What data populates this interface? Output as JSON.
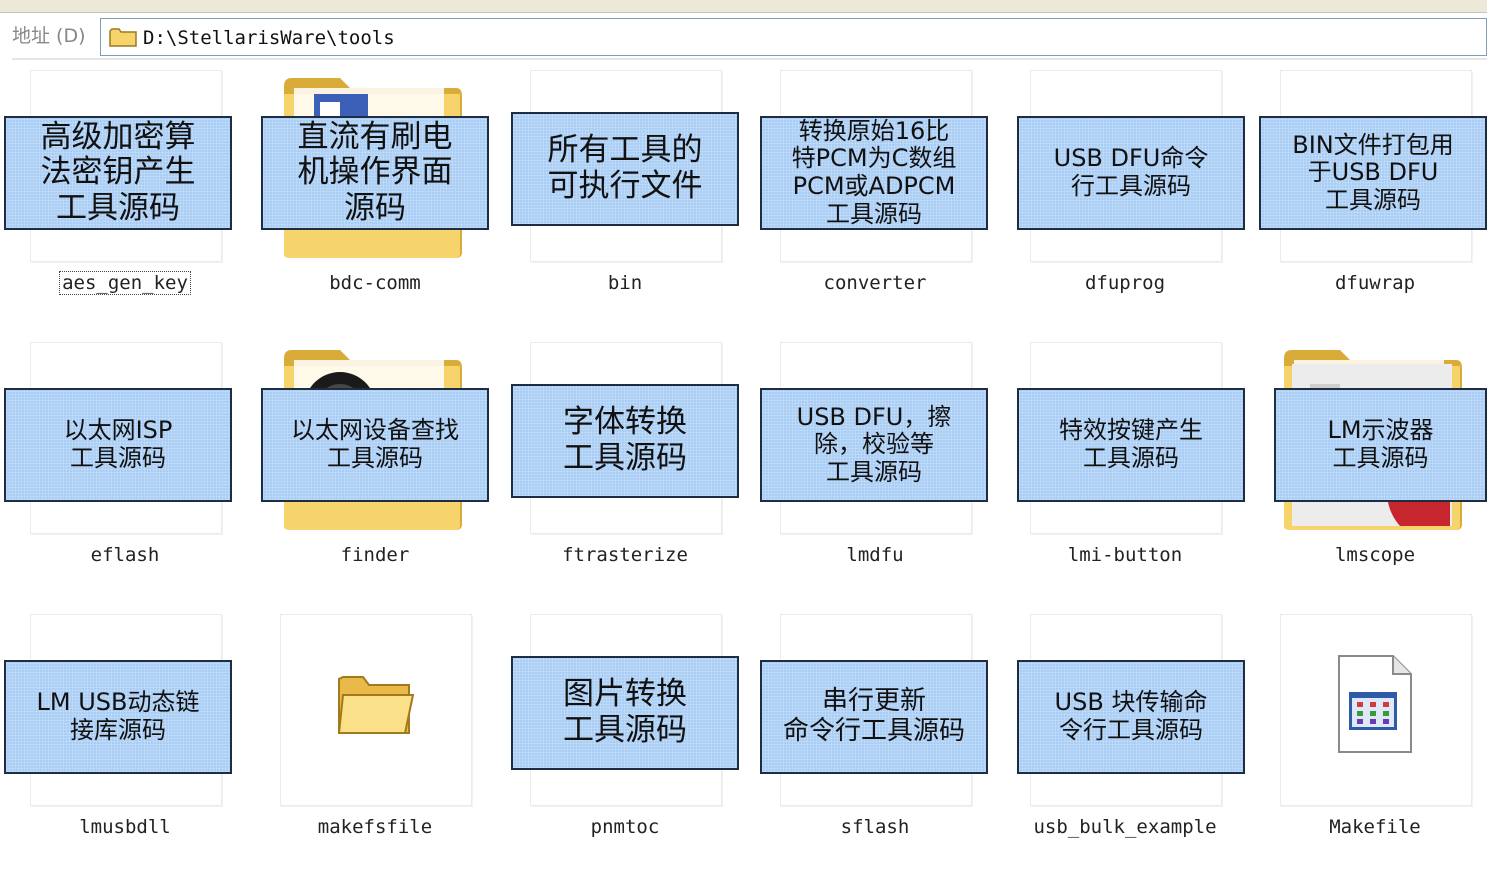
{
  "address_bar": {
    "label": "地址 (D)",
    "path": "D:\\StellarisWare\\tools"
  },
  "items": [
    {
      "name": "aes_gen_key",
      "note": "高级加密算\n法密钥产生\n工具源码",
      "icon": "blank-thumbnail"
    },
    {
      "name": "bdc-comm",
      "note": "直流有刷电\n机操作界面\n源码",
      "icon": "folder-icon"
    },
    {
      "name": "bin",
      "note": "所有工具的\n可执行文件",
      "icon": "blank-thumbnail"
    },
    {
      "name": "converter",
      "note": "转换原始16比\n特PCM为C数组\nPCM或ADPCM\n工具源码",
      "icon": "blank-thumbnail"
    },
    {
      "name": "dfuprog",
      "note": "USB DFU命令\n行工具源码",
      "icon": "blank-thumbnail"
    },
    {
      "name": "dfuwrap",
      "note": "BIN文件打包用\n于USB DFU\n工具源码",
      "icon": "blank-thumbnail"
    },
    {
      "name": "eflash",
      "note": "以太网ISP\n工具源码",
      "icon": "blank-thumbnail"
    },
    {
      "name": "finder",
      "note": "以太网设备查找\n工具源码",
      "icon": "folder-icon"
    },
    {
      "name": "ftrasterize",
      "note": "字体转换\n工具源码",
      "icon": "blank-thumbnail"
    },
    {
      "name": "lmdfu",
      "note": "USB DFU，擦\n除，校验等\n工具源码",
      "icon": "blank-thumbnail"
    },
    {
      "name": "lmi-button",
      "note": "特效按键产生\n工具源码",
      "icon": "blank-thumbnail"
    },
    {
      "name": "lmscope",
      "note": "LM示波器\n工具源码",
      "icon": "folder-icon"
    },
    {
      "name": "lmusbdll",
      "note": "LM USB动态链\n接库源码",
      "icon": "blank-thumbnail"
    },
    {
      "name": "makefsfile",
      "note": "",
      "icon": "small-folder-icon"
    },
    {
      "name": "pnmtoc",
      "note": "图片转换\n工具源码",
      "icon": "blank-thumbnail"
    },
    {
      "name": "sflash",
      "note": "串行更新\n命令行工具源码",
      "icon": "blank-thumbnail"
    },
    {
      "name": "usb_bulk_example",
      "note": "USB 块传输命\n令行工具源码",
      "icon": "blank-thumbnail"
    },
    {
      "name": "Makefile",
      "note": "",
      "icon": "makefile-icon"
    }
  ],
  "colors": {
    "note_fill": "#a9cdf4",
    "note_border": "#1d2d44",
    "folder": "#f7d36b"
  }
}
